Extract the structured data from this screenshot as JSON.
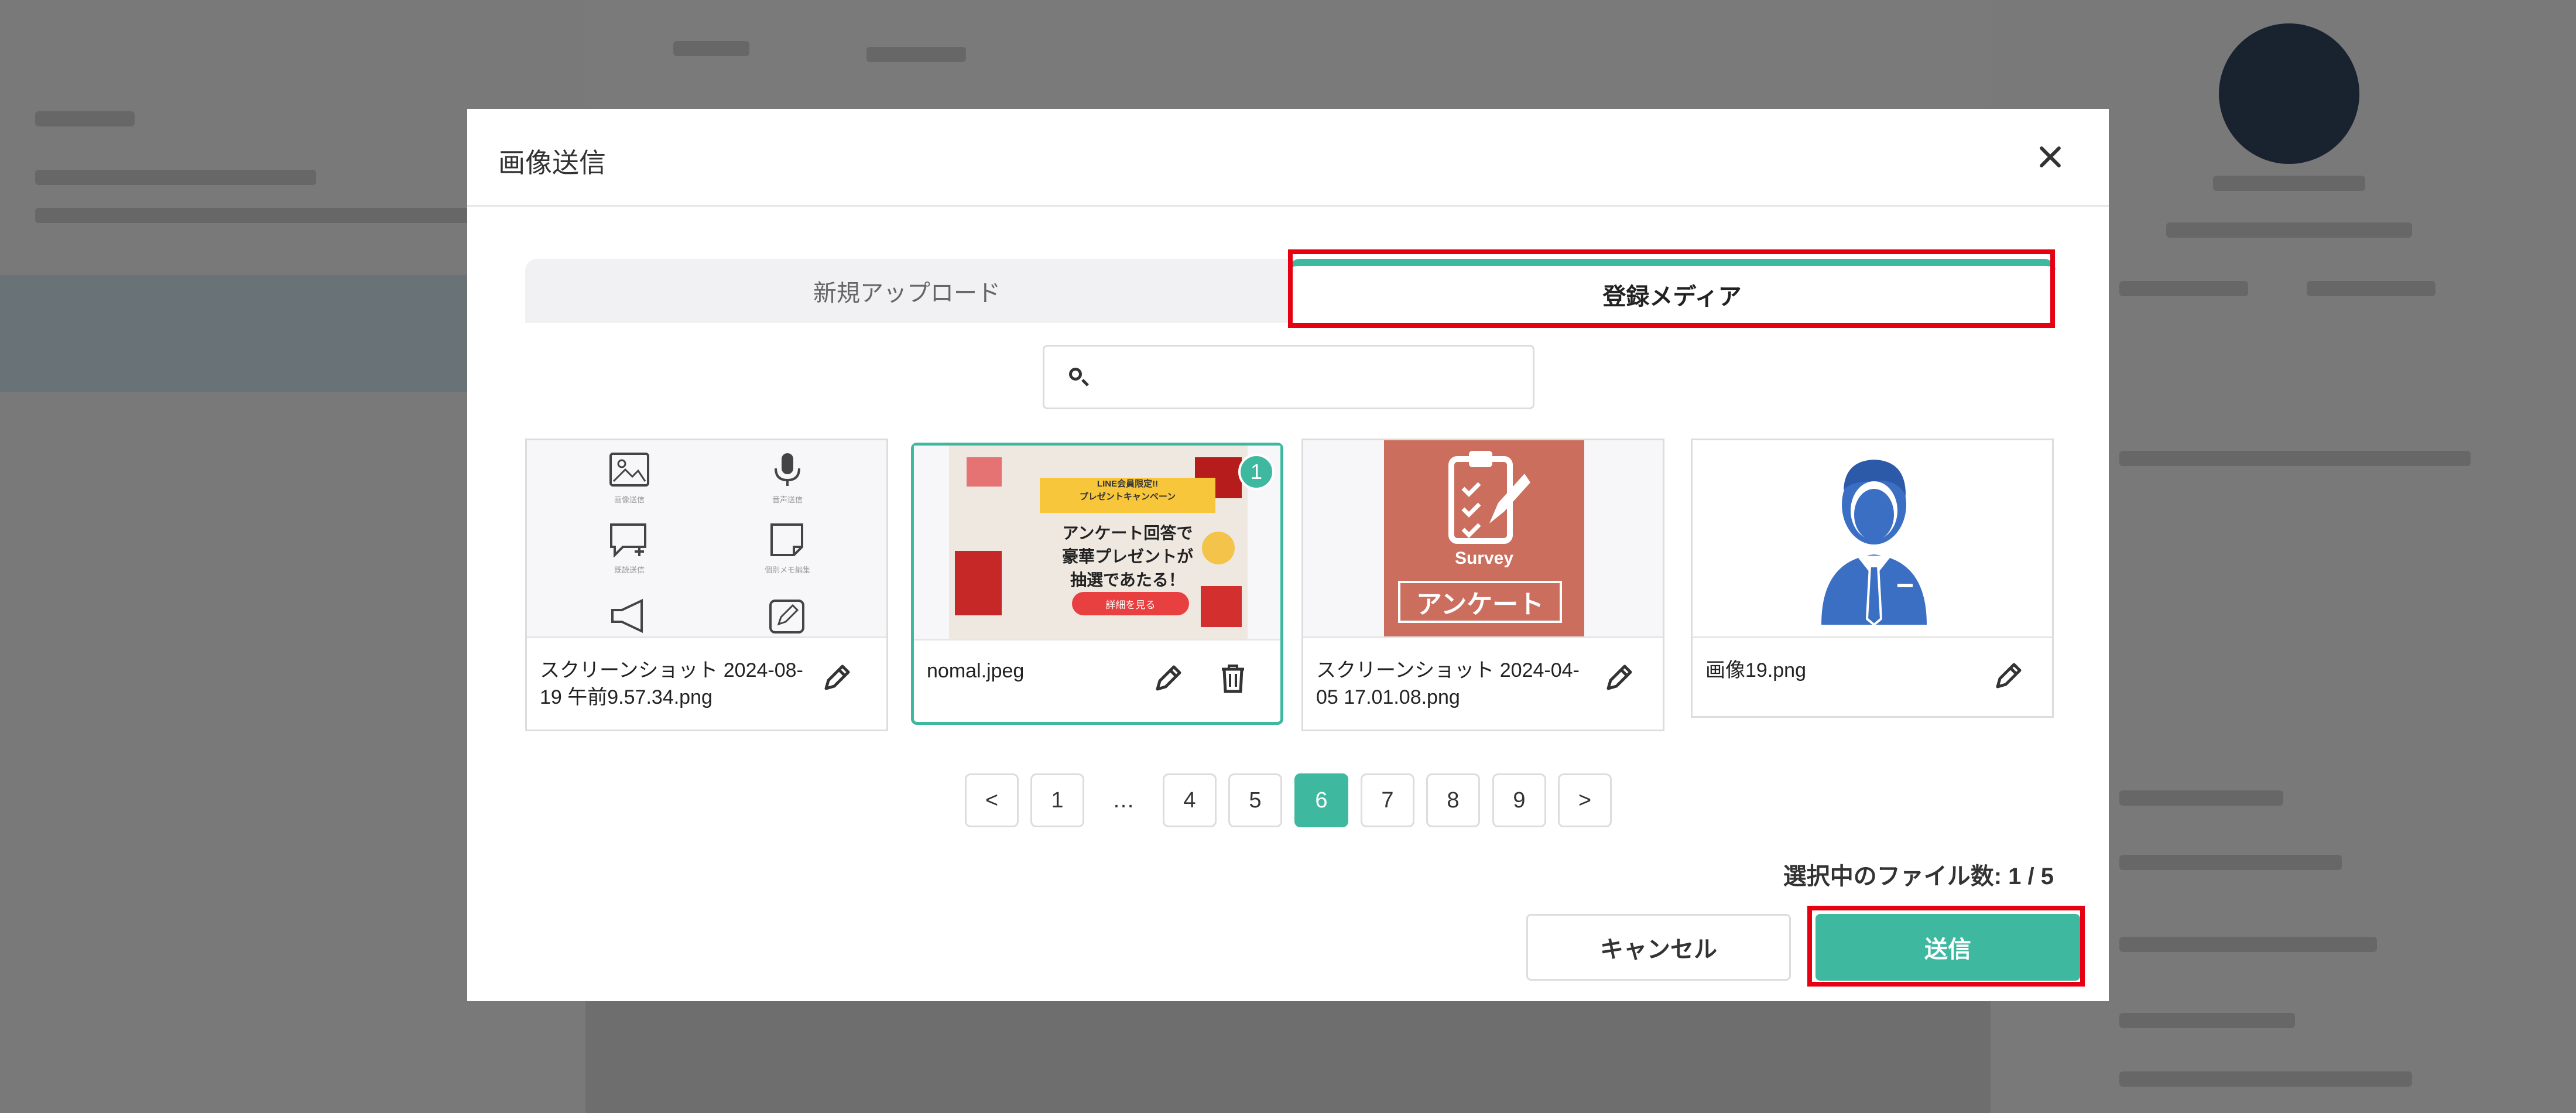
{
  "modal": {
    "title": "画像送信",
    "tabs": [
      {
        "label": "新規アップロード",
        "active": false
      },
      {
        "label": "登録メディア",
        "active": true
      }
    ],
    "search": {
      "placeholder": ""
    },
    "media": [
      {
        "name": "スクリーンショット 2024-08-19 午前9.57.34.png",
        "selected": false,
        "thumb_labels": [
          "画像送信",
          "音声送信",
          "既読送信",
          "個別メモ編集"
        ]
      },
      {
        "name": "nomal.jpeg",
        "selected": true,
        "badge": "1",
        "promo": {
          "banner": "LINE会員限定!!\nプレゼントキャンペーン",
          "text": "アンケート回答で\n豪華プレゼントが\n抽選であたる！",
          "button": "詳細を見る"
        }
      },
      {
        "name": "スクリーンショット 2024-04-05 17.01.08.png",
        "selected": false,
        "survey": {
          "label": "Survey",
          "tag": "アンケート"
        }
      },
      {
        "name": "画像19.png",
        "selected": false
      }
    ],
    "pagination": {
      "prev": "<",
      "pages": [
        "1",
        "…",
        "4",
        "5",
        "6",
        "7",
        "8",
        "9"
      ],
      "current": "6",
      "next": ">"
    },
    "selected_count": "選択中のファイル数: 1 / 5",
    "buttons": {
      "cancel": "キャンセル",
      "send": "送信"
    }
  },
  "colors": {
    "accent": "#3fb8a0",
    "highlight": "#e60012"
  }
}
